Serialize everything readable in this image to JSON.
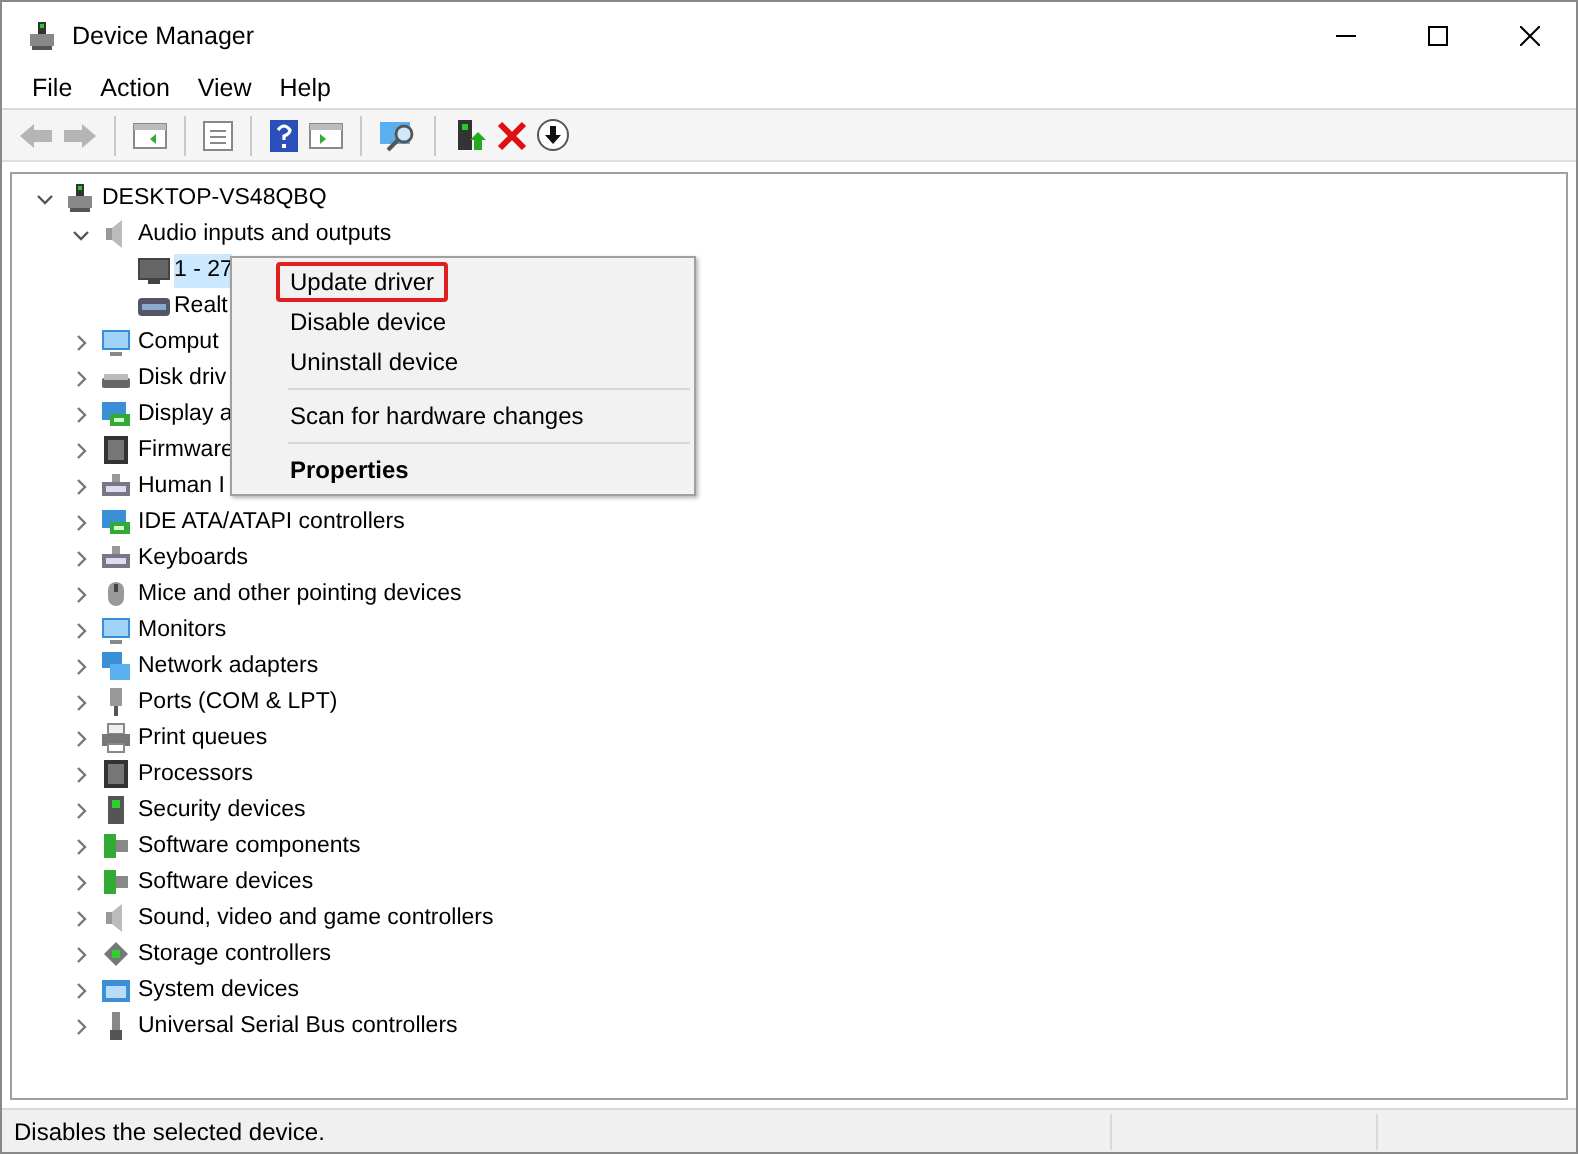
{
  "window": {
    "title": "Device Manager"
  },
  "menu_bar": [
    {
      "label": "File"
    },
    {
      "label": "Action"
    },
    {
      "label": "View"
    },
    {
      "label": "Help"
    }
  ],
  "toolbar": [
    {
      "kind": "back",
      "disabled": true
    },
    {
      "kind": "forward",
      "disabled": true
    },
    {
      "kind": "separator"
    },
    {
      "kind": "console"
    },
    {
      "kind": "separator"
    },
    {
      "kind": "properties"
    },
    {
      "kind": "separator"
    },
    {
      "kind": "help"
    },
    {
      "kind": "action"
    },
    {
      "kind": "separator"
    },
    {
      "kind": "scan"
    },
    {
      "kind": "separator"
    },
    {
      "kind": "update"
    },
    {
      "kind": "uninstall"
    },
    {
      "kind": "download"
    }
  ],
  "tree": [
    {
      "label": "DESKTOP-VS48QBQ",
      "kind": "computer",
      "expanded": true,
      "selected": false,
      "children": [
        {
          "label": "Audio inputs and outputs",
          "kind": "speaker",
          "expanded": true,
          "selected": false,
          "children": [
            {
              "label": "1 - 27",
              "kind": "monitor",
              "selected": true
            },
            {
              "label": "Realt",
              "kind": "soundcard",
              "selected": false
            }
          ]
        },
        {
          "label": "Comput",
          "kind": "display",
          "expanded": false,
          "selected": false
        },
        {
          "label": "Disk driv",
          "kind": "disk",
          "expanded": false,
          "selected": false
        },
        {
          "label": "Display a",
          "kind": "adapter",
          "expanded": false,
          "selected": false
        },
        {
          "label": "Firmware",
          "kind": "chip",
          "expanded": false,
          "selected": false
        },
        {
          "label": "Human I",
          "kind": "keyboard",
          "expanded": false,
          "selected": false
        },
        {
          "label": "IDE ATA/ATAPI controllers",
          "kind": "adapter",
          "expanded": false,
          "selected": false
        },
        {
          "label": "Keyboards",
          "kind": "keyboard",
          "expanded": false,
          "selected": false
        },
        {
          "label": "Mice and other pointing devices",
          "kind": "mouse",
          "expanded": false,
          "selected": false
        },
        {
          "label": "Monitors",
          "kind": "display",
          "expanded": false,
          "selected": false
        },
        {
          "label": "Network adapters",
          "kind": "network",
          "expanded": false,
          "selected": false
        },
        {
          "label": "Ports (COM & LPT)",
          "kind": "port",
          "expanded": false,
          "selected": false
        },
        {
          "label": "Print queues",
          "kind": "printer",
          "expanded": false,
          "selected": false
        },
        {
          "label": "Processors",
          "kind": "chip",
          "expanded": false,
          "selected": false
        },
        {
          "label": "Security devices",
          "kind": "security",
          "expanded": false,
          "selected": false
        },
        {
          "label": "Software components",
          "kind": "component",
          "expanded": false,
          "selected": false
        },
        {
          "label": "Software devices",
          "kind": "component",
          "expanded": false,
          "selected": false
        },
        {
          "label": "Sound, video and game controllers",
          "kind": "speaker",
          "expanded": false,
          "selected": false
        },
        {
          "label": "Storage controllers",
          "kind": "storage",
          "expanded": false,
          "selected": false
        },
        {
          "label": "System devices",
          "kind": "system",
          "expanded": false,
          "selected": false
        },
        {
          "label": "Universal Serial Bus controllers",
          "kind": "usb",
          "expanded": false,
          "selected": false
        }
      ]
    }
  ],
  "context_menu": [
    {
      "label": "Update driver",
      "highlighted": true,
      "bold": false
    },
    {
      "label": "Disable device",
      "highlighted": false,
      "bold": false
    },
    {
      "label": "Uninstall device",
      "highlighted": false,
      "bold": false
    },
    {
      "kind": "separator"
    },
    {
      "label": "Scan for hardware changes",
      "highlighted": false,
      "bold": false
    },
    {
      "kind": "separator"
    },
    {
      "label": "Properties",
      "highlighted": false,
      "bold": true
    }
  ],
  "status_bar": {
    "text": "Disables the selected device."
  }
}
